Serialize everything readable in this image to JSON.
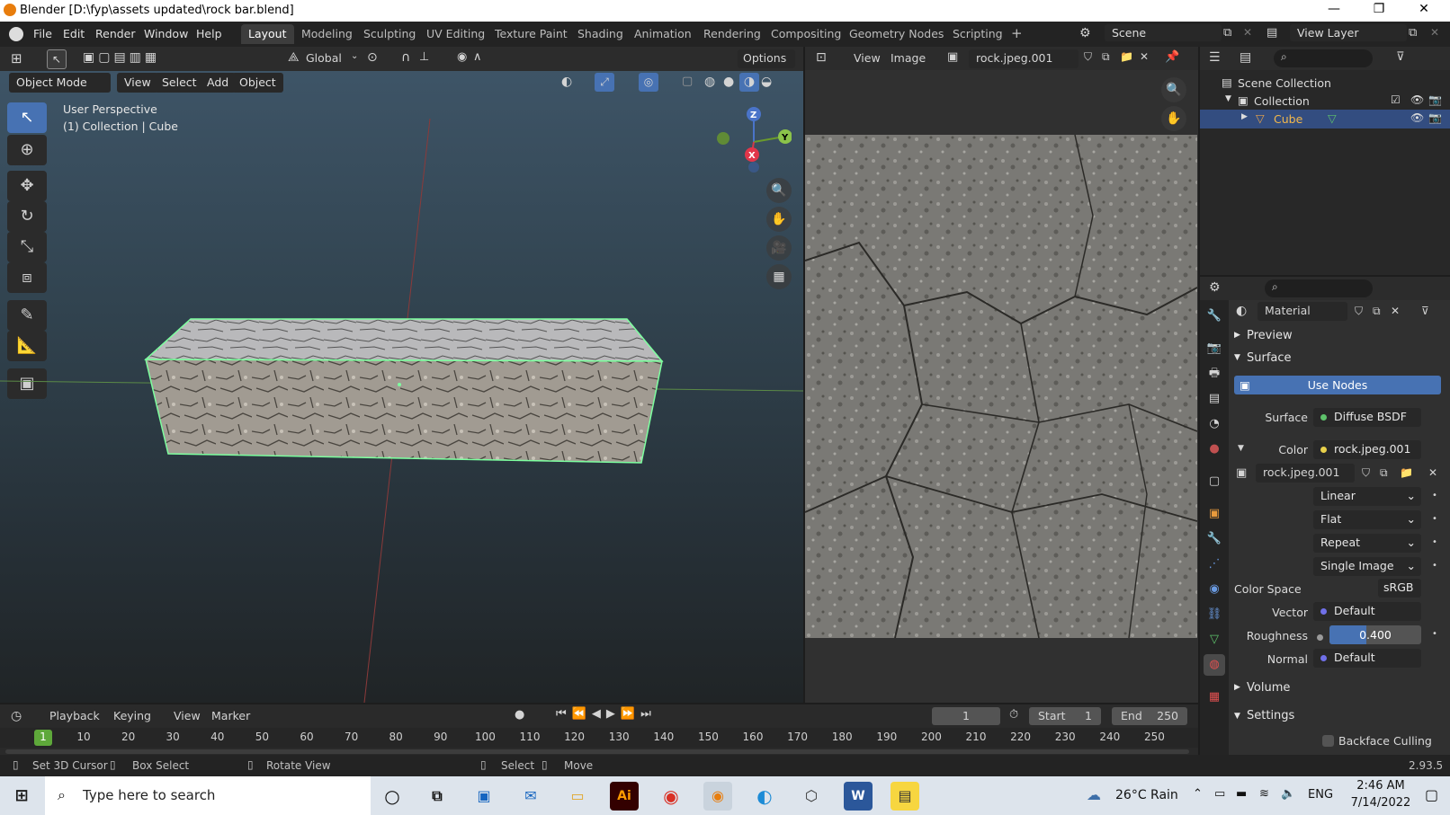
{
  "window": {
    "title": "Blender [D:\\fyp\\assets updated\\rock bar.blend]",
    "minimize": "—",
    "maximize": "❐",
    "close": "✕"
  },
  "menus": [
    "File",
    "Edit",
    "Render",
    "Window",
    "Help"
  ],
  "workspaces": [
    "Layout",
    "Modeling",
    "Sculpting",
    "UV Editing",
    "Texture Paint",
    "Shading",
    "Animation",
    "Rendering",
    "Compositing",
    "Geometry Nodes",
    "Scripting"
  ],
  "workspace_active": "Layout",
  "scene": {
    "name": "Scene",
    "view_layer": "View Layer"
  },
  "viewport": {
    "mode": "Object Mode",
    "menus": [
      "View",
      "Select",
      "Add",
      "Object"
    ],
    "transform": "Global",
    "options": "Options",
    "overlay_line1": "User Perspective",
    "overlay_line2": "(1) Collection | Cube",
    "gizmo": {
      "z": "Z",
      "y": "Y",
      "x": "X"
    }
  },
  "image_editor": {
    "menus": [
      "View",
      "Image"
    ],
    "image_name": "rock.jpeg.001"
  },
  "outliner": {
    "scene_collection": "Scene Collection",
    "collection": "Collection",
    "object": "Cube"
  },
  "properties": {
    "material_name": "Material",
    "sections": {
      "preview": "Preview",
      "surface": "Surface",
      "volume": "Volume",
      "settings": "Settings"
    },
    "use_nodes": "Use Nodes",
    "surface_label": "Surface",
    "surface_value": "Diffuse BSDF",
    "color_label": "Color",
    "color_value": "rock.jpeg.001",
    "image_name": "rock.jpeg.001",
    "interpolation": "Linear",
    "projection": "Flat",
    "extension": "Repeat",
    "source": "Single Image",
    "color_space_label": "Color Space",
    "color_space_value": "sRGB",
    "vector_label": "Vector",
    "vector_value": "Default",
    "roughness_label": "Roughness",
    "roughness_value": "0.400",
    "roughness_fraction": 0.4,
    "normal_label": "Normal",
    "normal_value": "Default",
    "backface_culling": "Backface Culling"
  },
  "timeline": {
    "menus": [
      "Playback",
      "Keying",
      "View",
      "Marker"
    ],
    "current_frame": "1",
    "start_label": "Start",
    "start_value": "1",
    "end_label": "End",
    "end_value": "250",
    "ruler": [
      "10",
      "20",
      "30",
      "40",
      "50",
      "60",
      "70",
      "80",
      "90",
      "100",
      "110",
      "120",
      "130",
      "140",
      "150",
      "160",
      "170",
      "180",
      "190",
      "200",
      "210",
      "220",
      "230",
      "240",
      "250"
    ],
    "ruler_current": "1"
  },
  "statusbar": {
    "set_cursor": "Set 3D Cursor",
    "box_select": "Box Select",
    "rotate_view": "Rotate View",
    "select": "Select",
    "move": "Move",
    "version": "2.93.5"
  },
  "taskbar": {
    "search_placeholder": "Type here to search",
    "weather": "26°C  Rain",
    "lang": "ENG",
    "time": "2:46 AM",
    "date": "7/14/2022",
    "apps": [
      "Ai",
      "W"
    ]
  },
  "colors": {
    "accent": "#4772b3",
    "selection_outline": "#7dff9f",
    "blender_orange": "#e87d0d"
  }
}
